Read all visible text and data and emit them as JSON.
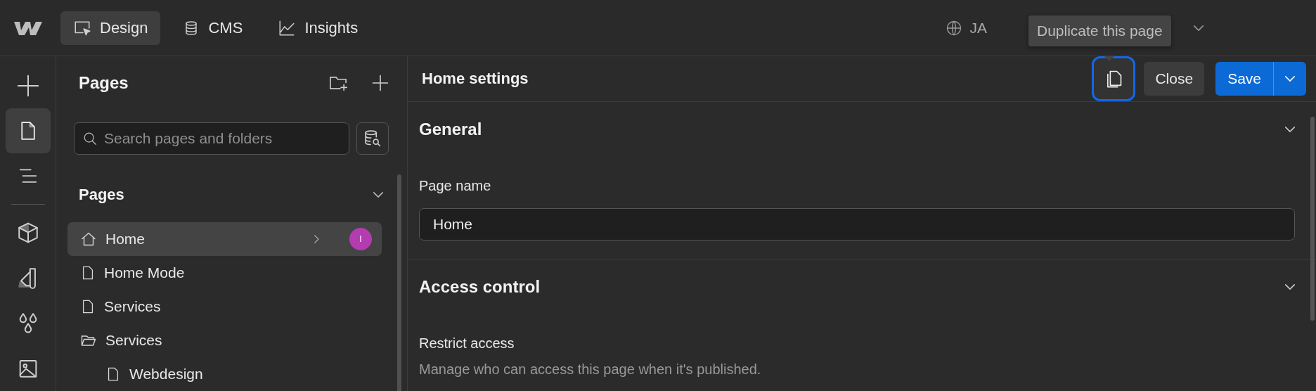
{
  "topbar": {
    "tabs": [
      {
        "label": "Design",
        "kind": "design",
        "selected": true
      },
      {
        "label": "CMS",
        "kind": "cms",
        "selected": false
      },
      {
        "label": "Insights",
        "kind": "insights",
        "selected": false
      }
    ],
    "locale": "JA"
  },
  "tooltip": "Duplicate this page",
  "rail": [
    {
      "kind": "plus",
      "selected": false
    },
    {
      "kind": "page",
      "selected": true
    },
    {
      "kind": "navigator",
      "selected": false
    },
    {
      "kind": "cube",
      "selected": false
    },
    {
      "kind": "styles",
      "selected": false
    },
    {
      "kind": "drops",
      "selected": false
    },
    {
      "kind": "image",
      "selected": false
    }
  ],
  "pages_panel": {
    "title": "Pages",
    "search": {
      "placeholder": "Search pages and folders"
    },
    "section": {
      "title": "Pages",
      "expanded": true
    },
    "items": [
      {
        "label": "Home",
        "kind": "home",
        "selected": true,
        "badge": {
          "text": "I",
          "color": "#b43cb0"
        }
      },
      {
        "label": "Home Mode",
        "kind": "page",
        "selected": false
      },
      {
        "label": "Services",
        "kind": "page",
        "selected": false
      },
      {
        "label": "Services",
        "kind": "folder",
        "selected": false,
        "children": [
          {
            "label": "Webdesign",
            "kind": "page",
            "selected": false
          }
        ]
      }
    ]
  },
  "settings": {
    "title": "Home settings",
    "duplicate_focused": true,
    "close": "Close",
    "save": "Save",
    "sections": [
      {
        "title": "General",
        "expanded": true,
        "fields": [
          {
            "label": "Page name",
            "value": "Home"
          }
        ]
      },
      {
        "title": "Access control",
        "expanded": true,
        "fields": [
          {
            "label": "Restrict access",
            "description": "Manage who can access this page when it's published."
          }
        ]
      }
    ]
  }
}
